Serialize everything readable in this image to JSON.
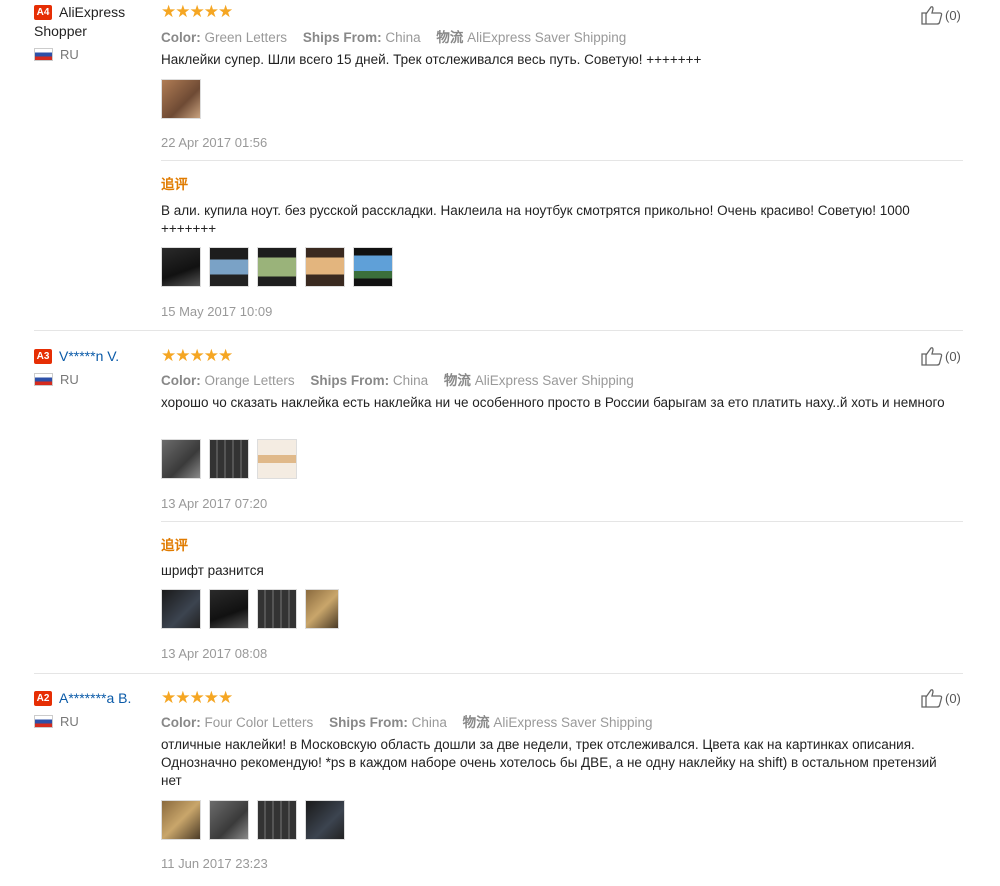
{
  "reviews": [
    {
      "level": "A4",
      "user_line1": "AliExpress",
      "user_line2": "Shopper",
      "country": "RU",
      "stars": 5,
      "color_key": "Color:",
      "color_value": "Green Letters",
      "ships_key": "Ships From:",
      "ships_value": "China",
      "logistics_key": "物流",
      "logistics_value": "AliExpress Saver Shipping",
      "text": "Наклейки супер. Шли всего 15 дней. Трек отслеживался весь путь. Советую! +++++++",
      "date": "22 Apr 2017 01:56",
      "likes": "(0)",
      "additional_label": "追评",
      "additional_text": "В али. купила ноут. без русской рассклaдки. Наклеила на ноутбук смотрятся прикольно! Очень красиво! Советую! 1000 +++++++",
      "additional_date": "15 May 2017 10:09"
    },
    {
      "level": "A3",
      "user": "V*****n V.",
      "country": "RU",
      "stars": 5,
      "color_key": "Color:",
      "color_value": "Orange Letters",
      "ships_key": "Ships From:",
      "ships_value": "China",
      "logistics_key": "物流",
      "logistics_value": "AliExpress Saver Shipping",
      "text": "хорошо чо сказать наклейка есть наклейка ни че особенного просто в России барыгам за ето платить наху..й хоть и немного",
      "date": "13 Apr 2017 07:20",
      "likes": "(0)",
      "additional_label": "追评",
      "additional_text": "шрифт разнится",
      "additional_date": "13 Apr 2017 08:08"
    },
    {
      "level": "A2",
      "user": "A*******a B.",
      "country": "RU",
      "stars": 5,
      "color_key": "Color:",
      "color_value": "Four Color Letters",
      "ships_key": "Ships From:",
      "ships_value": "China",
      "logistics_key": "物流",
      "logistics_value": "AliExpress Saver Shipping",
      "text": "отличные наклейки! в Московскую область дошли за две недели, трек отслеживался. Цвета как на картинках описания. Однозначно рекомендую! *ps в каждом наборе очень хотелось бы ДВЕ, а не одну наклейку на shift) в остальном претензий нет",
      "date": "11 Jun 2017 23:23",
      "likes": "(0)"
    }
  ],
  "icons": {
    "star": "★",
    "like": "thumbs-up-icon",
    "flag": "russia-flag-icon"
  },
  "colors": {
    "star": "#f5a623",
    "level_badge": "#e62e04",
    "link": "#0a5aa8",
    "additional": "#e07b00"
  }
}
